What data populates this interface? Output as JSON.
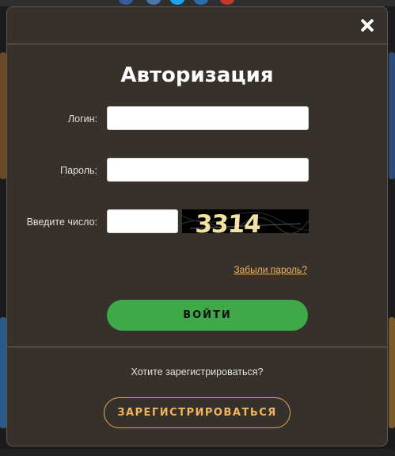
{
  "modal": {
    "title": "Авторизация",
    "close_icon": "close-icon"
  },
  "form": {
    "login_label": "Логин:",
    "login_value": "",
    "password_label": "Пароль:",
    "password_value": "",
    "captcha_label": "Введите число:",
    "captcha_value": "",
    "captcha_text": "3314"
  },
  "links": {
    "forgot_password": "Забыли пароль?"
  },
  "buttons": {
    "login": "ВОЙТИ",
    "register": "ЗАРЕГИСТРИРОВАТЬСЯ"
  },
  "register_prompt": "Хотите зарегистрироваться?",
  "colors": {
    "modal_bg": "#36312b",
    "accent_green": "#3fa94a",
    "accent_orange": "#f2b45c"
  }
}
